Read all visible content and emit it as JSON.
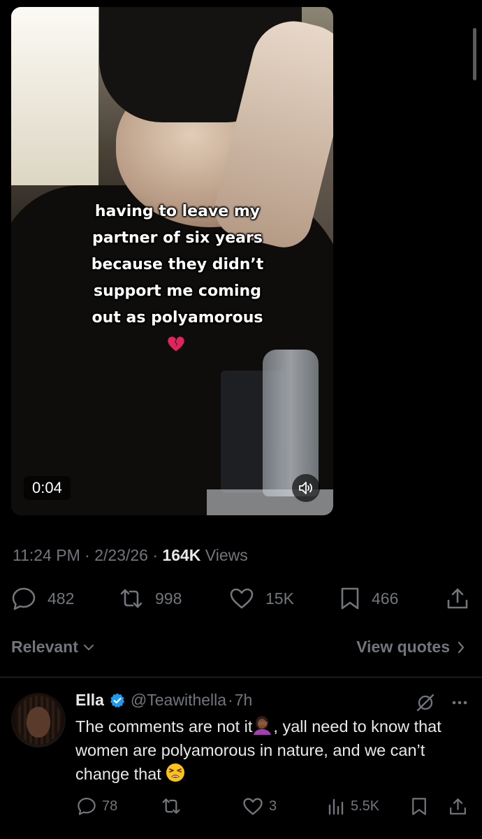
{
  "video": {
    "caption_lines": [
      "having to leave my",
      "partner of six years",
      "because they didn’t",
      "support me coming",
      "out as polyamorous"
    ],
    "time": "0:04"
  },
  "meta": {
    "time": "11:24 PM",
    "sep1": " · ",
    "date": "2/23/26",
    "sep2": " · ",
    "views_count": "164K",
    "views_label": " Views"
  },
  "actions": {
    "replies": "482",
    "reposts": "998",
    "likes": "15K",
    "bookmarks": "466"
  },
  "filter": {
    "relevant": "Relevant",
    "view_quotes": "View quotes"
  },
  "reply": {
    "name": "Ella",
    "handle": "@Teawithella",
    "dot": "·",
    "time": "7h",
    "text_part1": "The comments are not it",
    "text_part2": ",  yall need to know that women are polyamorous in nature, and we can’t change that ",
    "replies": "78",
    "reposts": "",
    "likes": "3",
    "views": "5.5K"
  },
  "colors": {
    "background": "#000000",
    "text": "#e7e9ea",
    "muted": "#71767b",
    "verified": "#1d9bf0",
    "divider": "#2f3336"
  }
}
